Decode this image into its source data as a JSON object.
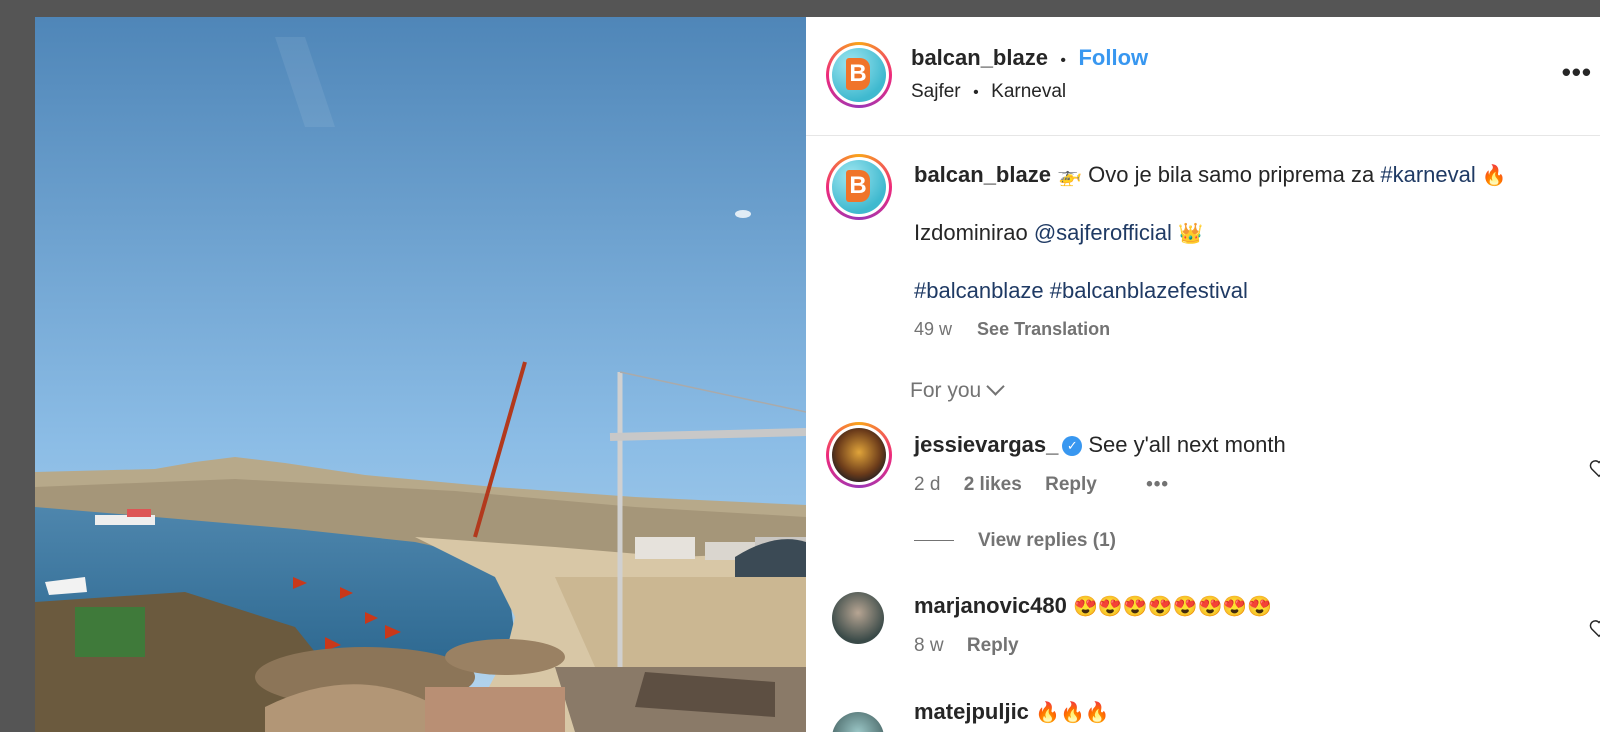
{
  "post": {
    "username": "balcan_blaze",
    "follow_label": "Follow",
    "subtitle_left": "Sajfer",
    "subtitle_right": "Karneval",
    "avatar_letter": "B"
  },
  "caption": {
    "username": "balcan_blaze",
    "emoji1": "🚁",
    "text1": "Ovo je bila samo priprema za",
    "hashtag1": "#karneval",
    "emoji2": "🔥",
    "line2_text": "Izdominirao",
    "mention": "@sajferofficial",
    "emoji3": "👑",
    "hashtags": "#balcanblaze #balcanblazefestival",
    "time": "49 w",
    "see_translation": "See Translation"
  },
  "sort": {
    "label": "For you"
  },
  "comments": [
    {
      "username": "jessievargas_",
      "verified": true,
      "text": "See y'all next month",
      "time": "2 d",
      "likes": "2 likes",
      "reply": "Reply",
      "more": "•••",
      "view_replies": "View replies (1)"
    },
    {
      "username": "marjanovic480",
      "text": "😍😍😍😍😍😍😍😍",
      "time": "8 w",
      "reply": "Reply"
    },
    {
      "username": "matejpuljic",
      "text": "🔥🔥🔥"
    }
  ],
  "icons": {
    "more": "more-dots-icon",
    "heart": "heart-icon",
    "verified": "verified-badge-icon",
    "chevron": "chevron-down-icon"
  },
  "colors": {
    "follow": "#3897f0",
    "hashtag": "#1f3a64",
    "muted": "#737373",
    "backdrop": "#555555"
  }
}
